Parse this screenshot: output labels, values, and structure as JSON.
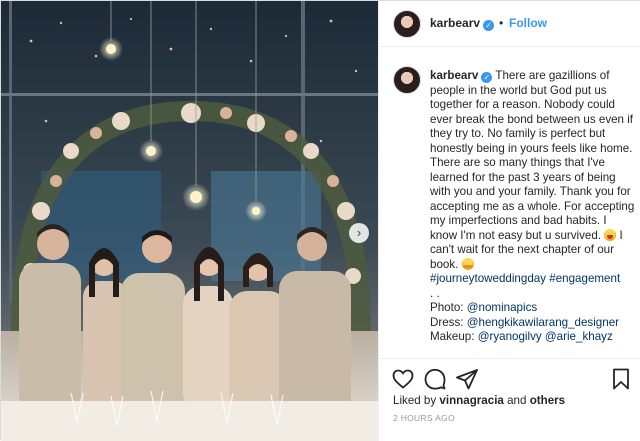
{
  "header": {
    "username": "karbearv",
    "verified": true,
    "separator": "•",
    "follow_label": "Follow"
  },
  "photo": {
    "icon": "chevron-right-icon",
    "alt_subject": "group-portrait"
  },
  "caption": {
    "username": "karbearv",
    "text_part1": "There are gazillions of people in the world but God put us together for a reason. Nobody could ever break the bond between us even if they try to. No family is perfect but honestly being in yours feels like home. There are so many things that I've learned for the past 3 years of being with you and your family. Thank you for accepting me as a whole. For accepting my imperfections and bad habits. I know I'm not easy but u survived.",
    "text_part2": "I can't wait for the next chapter of our book.",
    "hashtag1": "#journeytoweddingday",
    "hashtag2": "#engagement",
    "dots": ". .",
    "photo_label": "Photo:",
    "photo_credit": "@nominapics",
    "dress_label": "Dress:",
    "dress_credit": "@hengkikawilarang_designer",
    "makeup_label": "Makeup:",
    "makeup_credit1": "@ryanogilvy",
    "makeup_credit2": "@arie_khayz"
  },
  "engagement": {
    "liked_by_prefix": "Liked by",
    "liked_by_user": "vinnagracia",
    "liked_by_suffix": "and",
    "others_label": "others",
    "timestamp": "2 HOURS AGO"
  },
  "colors": {
    "link": "#003569",
    "accent": "#3897f0",
    "border": "#dbdbdb"
  }
}
